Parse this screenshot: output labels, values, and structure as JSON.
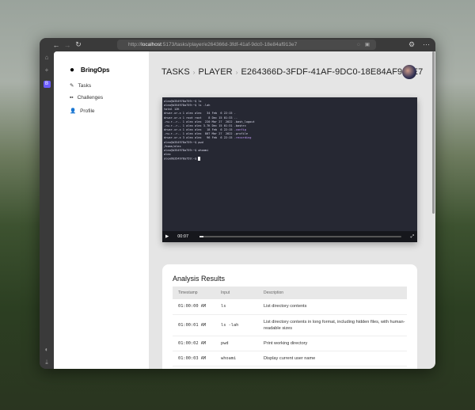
{
  "browser": {
    "url_prefix": "http://",
    "url_host": "localhost",
    "url_path": ":5173/tasks/player/e264366d-3fdf-41af-9dc0-18e84af913e7"
  },
  "sidebar": {
    "brand": "BringOps",
    "items": [
      {
        "label": "Tasks",
        "icon": "edit-icon"
      },
      {
        "label": "Challenges",
        "icon": "grid-icon"
      },
      {
        "label": "Profile",
        "icon": "user-icon"
      }
    ]
  },
  "breadcrumb": [
    "TASKS",
    "PLAYER",
    "E264366D-3FDF-41AF-9DC0-18E84AF913E7"
  ],
  "player": {
    "time": "00:07",
    "progress_percent": 2,
    "terminal": [
      {
        "t": "alex@b354978a759:~$ ls"
      },
      {
        "t": "alex@b354978a759:~$ ls -lah"
      },
      {
        "t": "total 12K"
      },
      {
        "t": "drwxr-xr-x 1 alex alex   34 Feb  6 22:15 ."
      },
      {
        "t": "drwxr-xr-x 1 root root    8 Dec 15 01:33 .."
      },
      {
        "t": "-rw-r--r-- 1 alex alex  220 Mar 27  2022 .bash_logout"
      },
      {
        "t": "-rw-r--r-- 1 alex alex 3.7K Dec 15 01:31 .bashrc"
      },
      {
        "t": "drwxr-xr-x 1 alex alex   18 Feb  6 22:15 ",
        "d": ".config"
      },
      {
        "t": "-rw-r--r-- 1 alex alex  807 Mar 27  2022 .profile"
      },
      {
        "t": "drwxr-xr-x 3 alex alex   96 Feb  6 22:15 ",
        "d": ".recording"
      },
      {
        "t": "alex@b354978a759:~$ pwd"
      },
      {
        "t": "/home/alex"
      },
      {
        "t": "alex@b354978a759:~$ whoami"
      },
      {
        "t": "alex"
      },
      {
        "t": "alex@b354978a759:~$ ",
        "cursor": true
      }
    ]
  },
  "analysis": {
    "title": "Analysis Results",
    "columns": [
      "Timestamp",
      "Input",
      "Description"
    ],
    "rows": [
      [
        "01:00:00 AM",
        "ls",
        "List directory contents"
      ],
      [
        "01:00:01 AM",
        "ls -lah",
        "List directory contents in long format, including hidden files, with human-readable sizes"
      ],
      [
        "01:00:02 AM",
        "pwd",
        "Print working directory"
      ],
      [
        "01:00:03 AM",
        "whoami",
        "Display current user name"
      ]
    ]
  }
}
